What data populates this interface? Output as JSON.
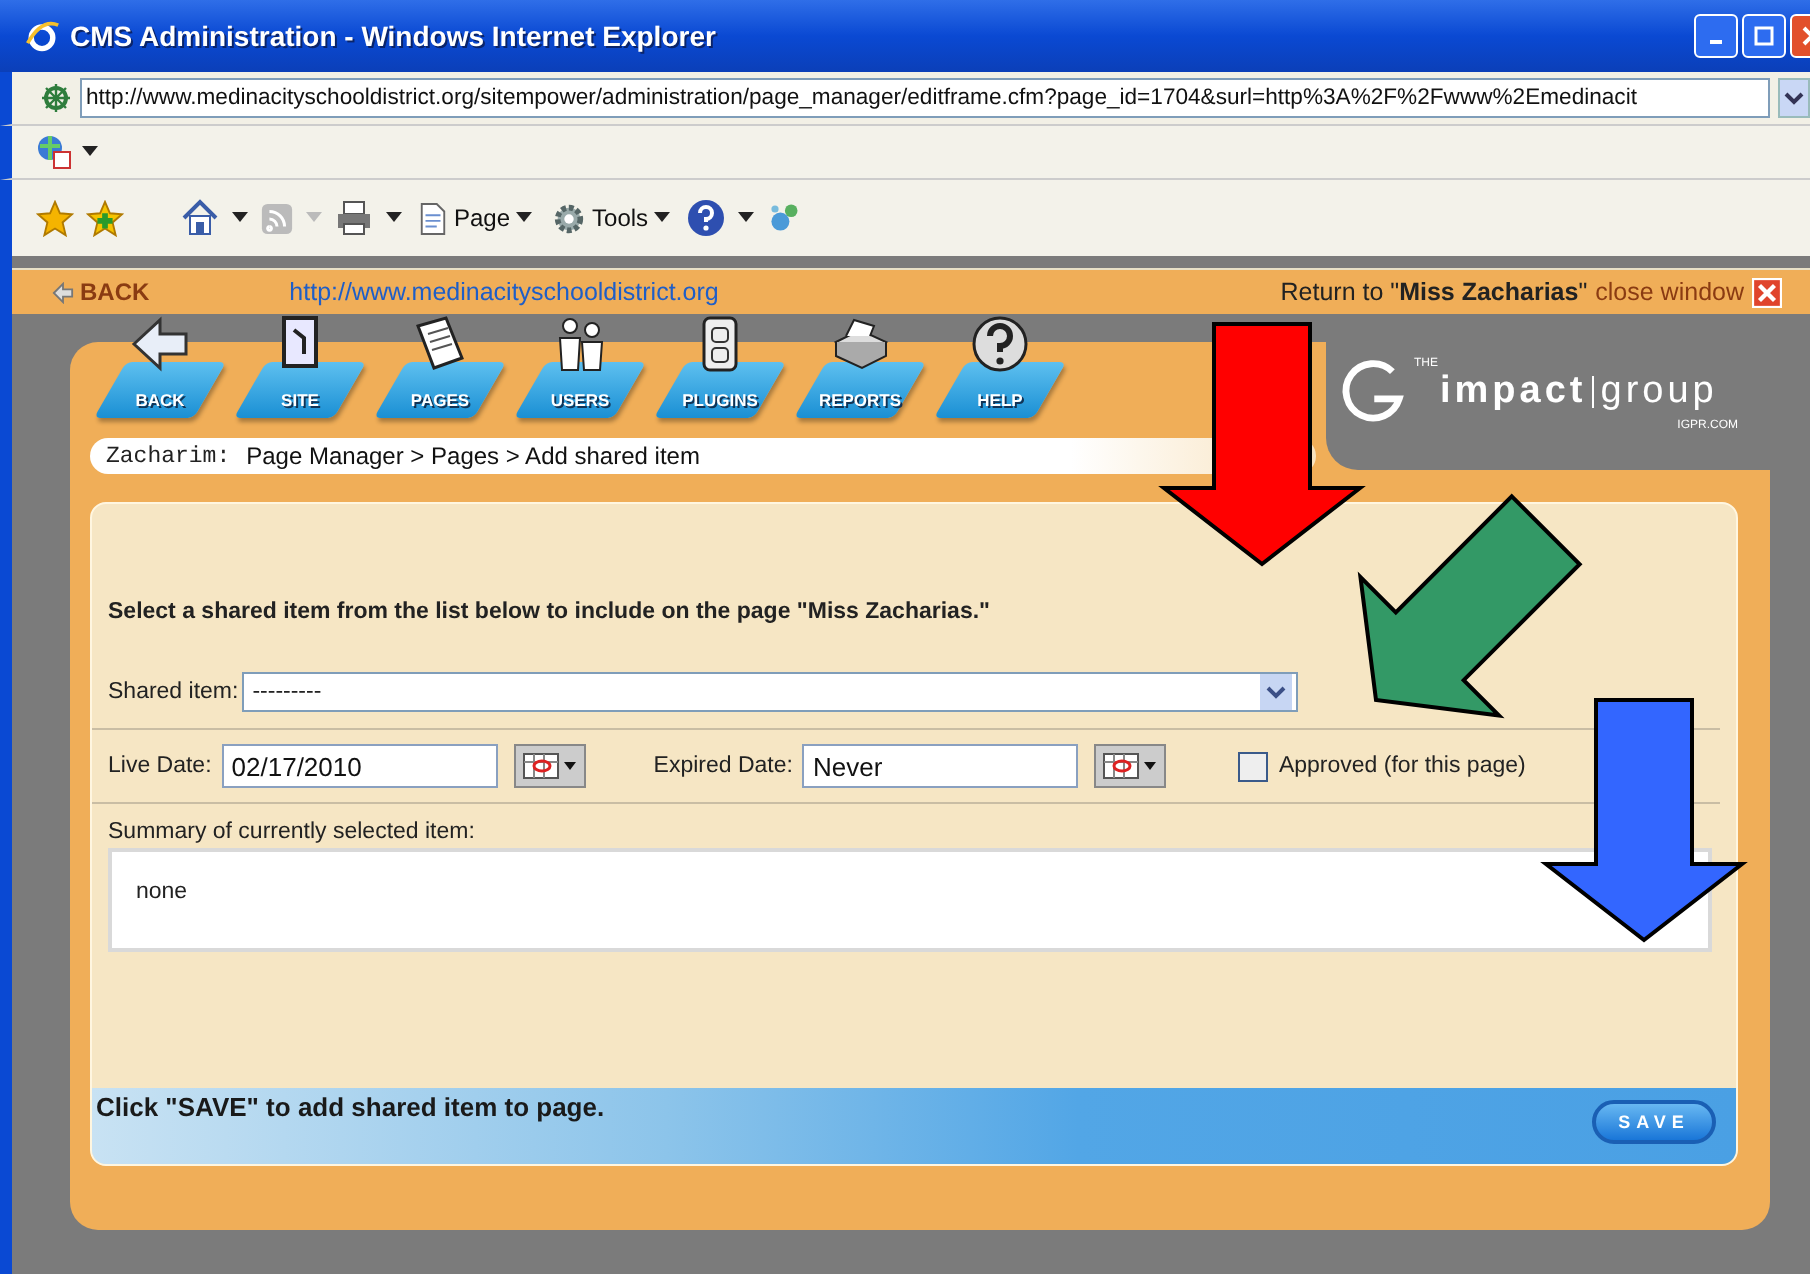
{
  "window": {
    "title": "CMS Administration - Windows Internet Explorer"
  },
  "address_bar": {
    "url": "http://www.medinacityschooldistrict.org/sitempower/administration/page_manager/editframe.cfm?page_id=1704&surl=http%3A%2F%2Fwww%2Emedinacit"
  },
  "command_bar": [
    {
      "kind": "page",
      "label": "Page"
    },
    {
      "kind": "tools",
      "label": "Tools"
    }
  ],
  "cms_header": {
    "back": "BACK",
    "site_url": "http://www.medinacityschooldistrict.org",
    "return_text": "Return to \"**Miss Zacharias**\"",
    "close": "close window"
  },
  "nav": [
    {
      "kind": "back",
      "label": "BACK"
    },
    {
      "kind": "site",
      "label": "SITE"
    },
    {
      "kind": "pages",
      "label": "PAGES"
    },
    {
      "kind": "users",
      "label": "USERS"
    },
    {
      "kind": "plugins",
      "label": "PLUGINS"
    },
    {
      "kind": "reports",
      "label": "REPORTS"
    },
    {
      "kind": "help",
      "label": "HELP"
    }
  ],
  "logo": {
    "small": "THE",
    "word1": "impact",
    "word2": "group",
    "domain": "IGPR.COM"
  },
  "breadcrumb": {
    "user": "Zacharim:",
    "path": "Page Manager > Pages > Add shared item"
  },
  "form": {
    "instruction": "Select a shared item from the list below to include on the page \"Miss Zacharias.\"",
    "shared_label": "Shared item:",
    "shared_value": "---------",
    "live_label": "Live Date:",
    "live_value": "02/17/2010",
    "expired_label": "Expired Date:",
    "expired_value": "Never",
    "approved_label": "Approved (for this page)",
    "approved_checked": false,
    "summary_label": "Summary of currently selected item:",
    "summary_value": "none"
  },
  "footer": {
    "text": "Click \"SAVE\" to add shared item to page.",
    "button": "SAVE"
  },
  "annotations": [
    {
      "kind": "down",
      "color": "#ff0000"
    },
    {
      "kind": "diagonal",
      "color": "#339966"
    },
    {
      "kind": "down",
      "color": "#3366ff"
    }
  ]
}
